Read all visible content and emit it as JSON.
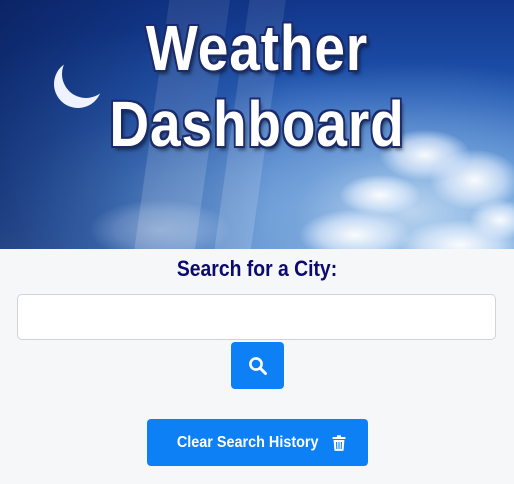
{
  "header": {
    "title_line1": "Weather",
    "title_line2": "Dashboard"
  },
  "search": {
    "label": "Search for a City:",
    "input_value": "",
    "placeholder": "",
    "button_icon": "search-icon"
  },
  "history": {
    "clear_label": "Clear Search History",
    "clear_icon": "trash-icon"
  },
  "colors": {
    "accent": "#0d80f5",
    "label_text": "#0b0a6e",
    "page_background": "#f6f7f9"
  }
}
